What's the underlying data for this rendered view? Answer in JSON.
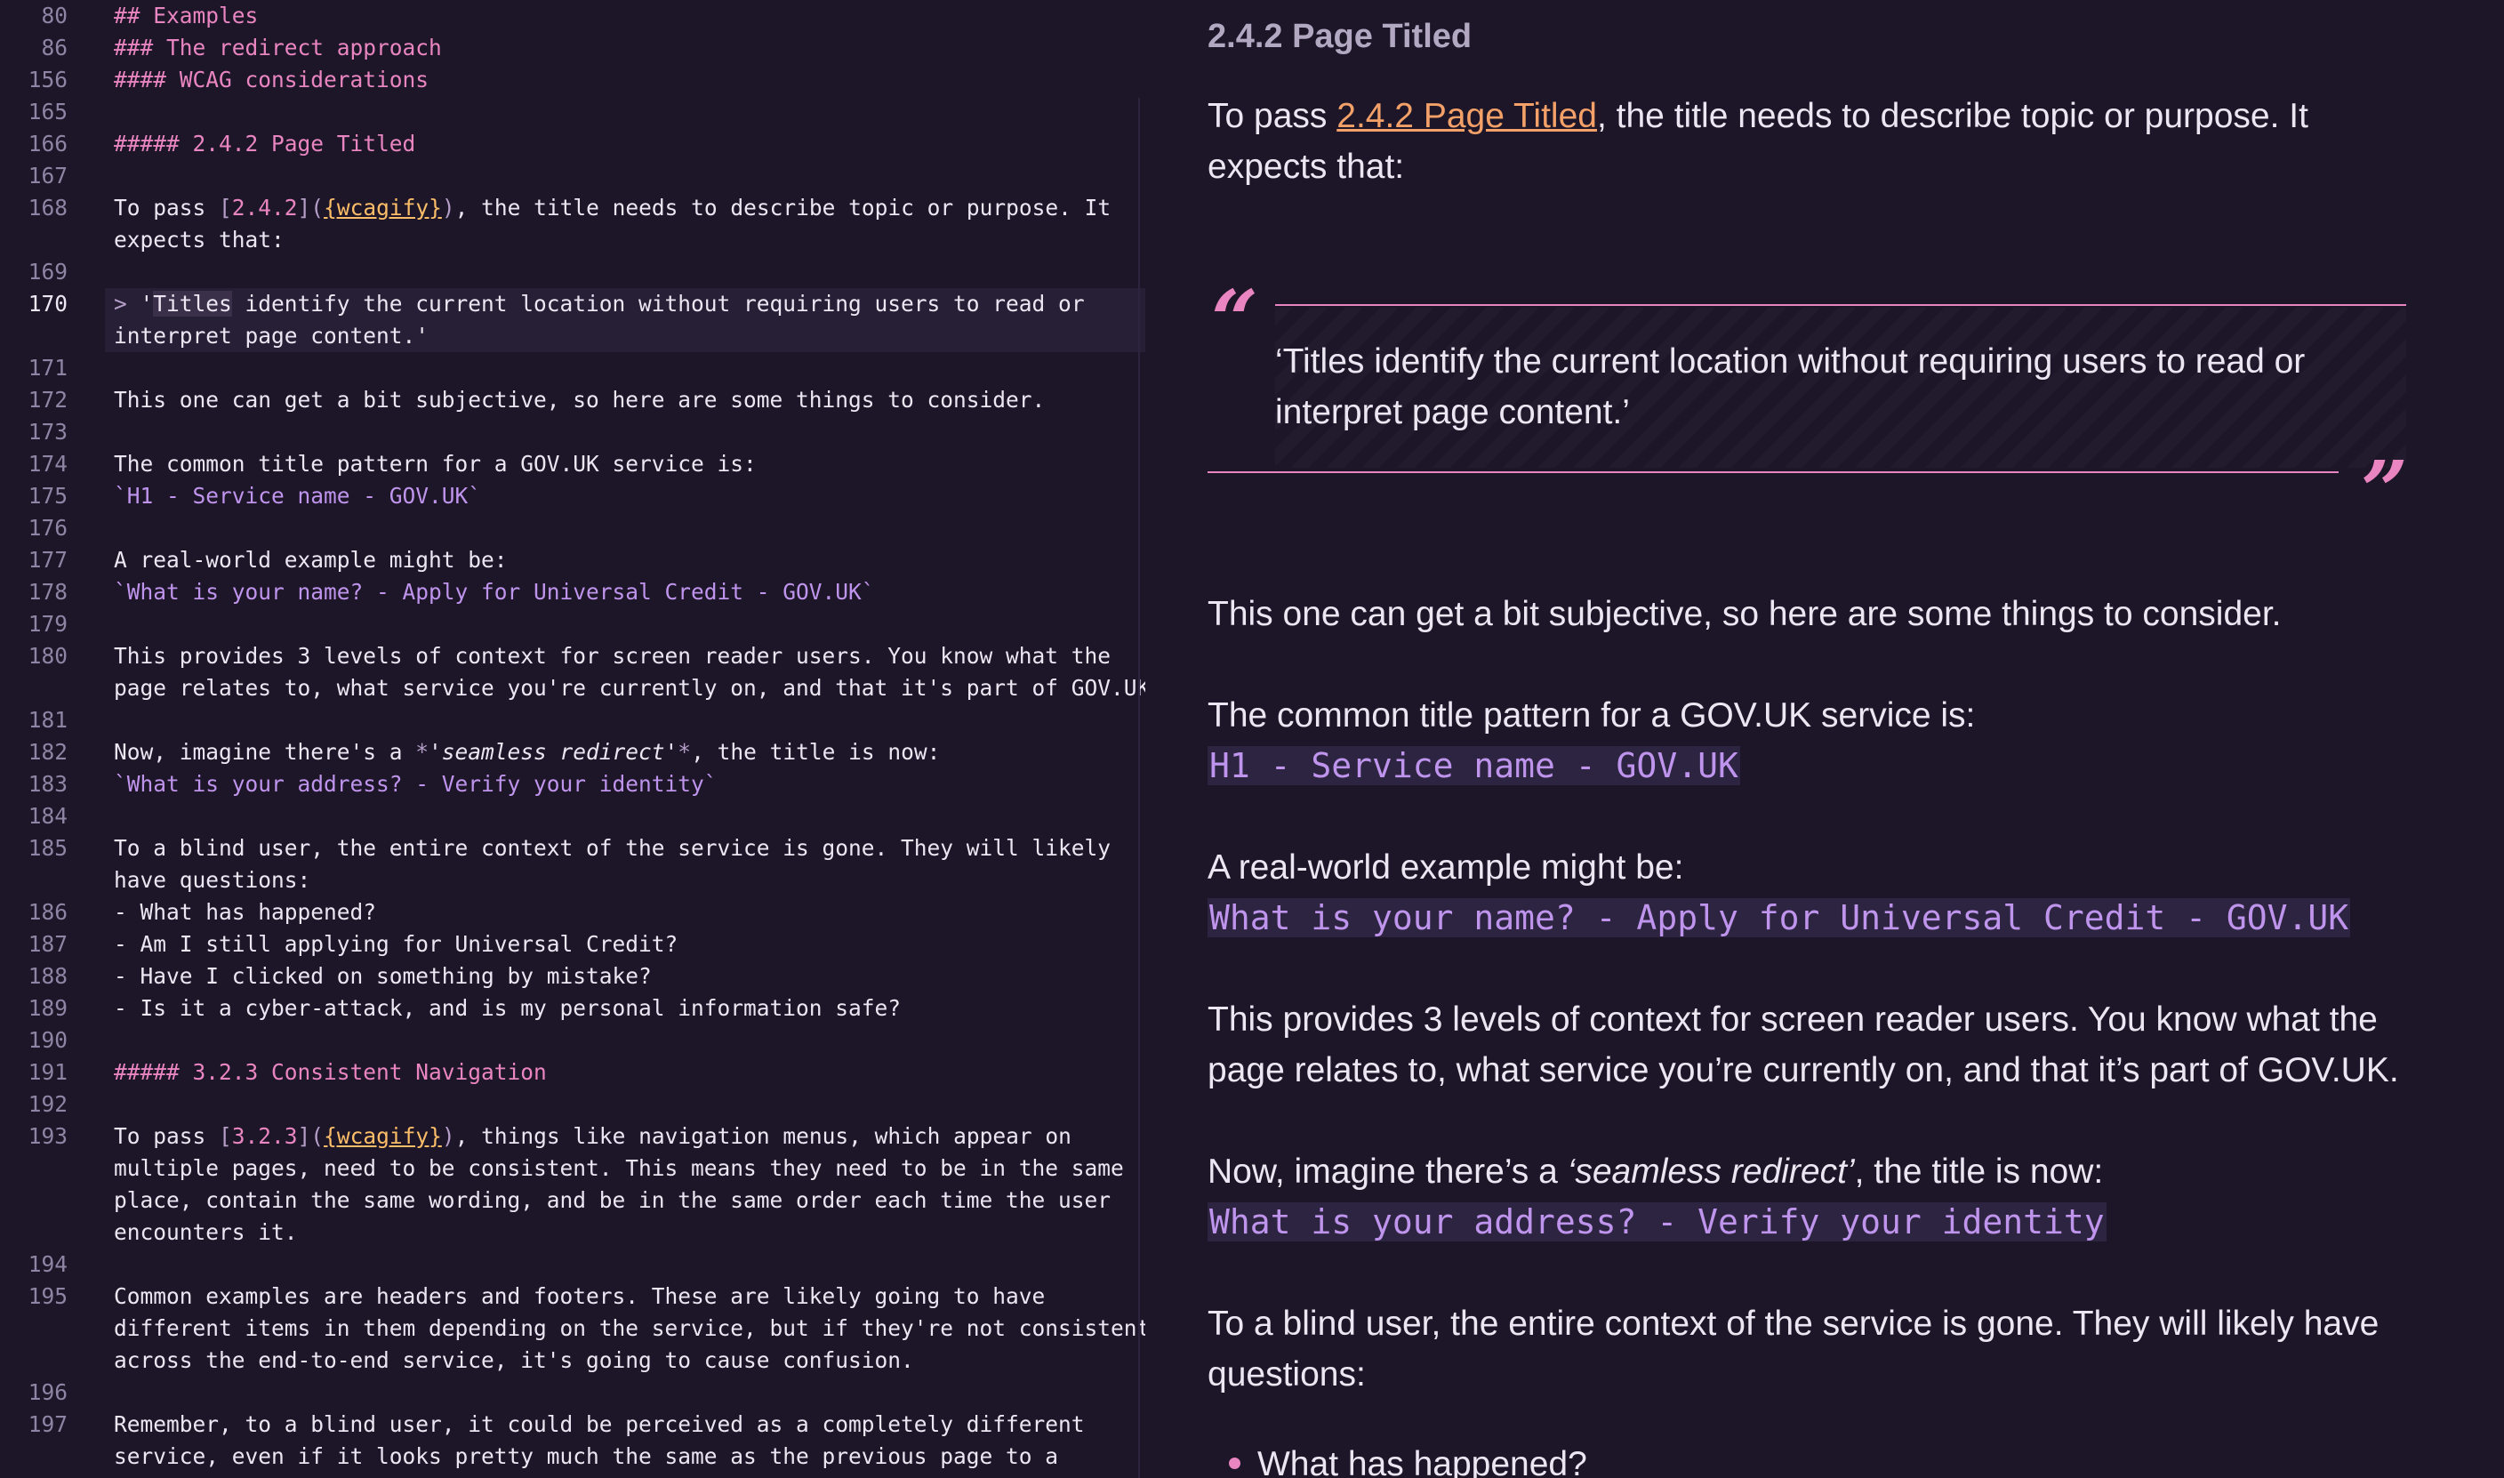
{
  "editor": {
    "sticky": [
      {
        "ln": "80",
        "md": "## ",
        "text": "Examples"
      },
      {
        "ln": "86",
        "md": "### ",
        "text": "The redirect approach"
      },
      {
        "ln": "156",
        "md": "#### ",
        "text": "WCAG considerations"
      }
    ],
    "lines": [
      {
        "ln": "165"
      },
      {
        "ln": "166",
        "md": "##### ",
        "text": "2.4.2 Page Titled"
      },
      {
        "ln": "167"
      },
      {
        "ln": "168",
        "pre": "To pass ",
        "lb": "[",
        "label": "2.4.2",
        "mid": "](",
        "url": "{wcagify}",
        "rp": ")",
        "post": ", the title needs to describe topic or purpose. It",
        "cont": "expects that:"
      },
      {
        "ln": "169"
      },
      {
        "ln": "170",
        "gt": "> ",
        "q1": "'",
        "sel": "Titles",
        "post": " identify the current location without requiring users to read or",
        "cont": "interpret page content.'"
      },
      {
        "ln": "171"
      },
      {
        "ln": "172",
        "text": "This one can get a bit subjective, so here are some things to consider."
      },
      {
        "ln": "173"
      },
      {
        "ln": "174",
        "text": "The common title pattern for a GOV.UK service is:"
      },
      {
        "ln": "175",
        "code": "`H1 - Service name - GOV.UK`"
      },
      {
        "ln": "176"
      },
      {
        "ln": "177",
        "text": "A real-world example might be:"
      },
      {
        "ln": "178",
        "code": "`What is your name? - Apply for Universal Credit - GOV.UK`"
      },
      {
        "ln": "179"
      },
      {
        "ln": "180",
        "text": "This provides 3 levels of context for screen reader users. You know what the",
        "cont": "page relates to, what service you're currently on, and that it's part of GOV.UK."
      },
      {
        "ln": "181"
      },
      {
        "ln": "182",
        "pre": "Now, imagine there's a ",
        "em_o": "*",
        "em": "'seamless redirect'",
        "em_c": "*",
        "post": ", the title is now:"
      },
      {
        "ln": "183",
        "code": "`What is your address? - Verify your identity`"
      },
      {
        "ln": "184"
      },
      {
        "ln": "185",
        "text": "To a blind user, the entire context of the service is gone. They will likely",
        "cont": "have questions:"
      },
      {
        "ln": "186",
        "text": "- What has happened?"
      },
      {
        "ln": "187",
        "text": "- Am I still applying for Universal Credit?"
      },
      {
        "ln": "188",
        "text": "- Have I clicked on something by mistake?"
      },
      {
        "ln": "189",
        "text": "- Is it a cyber-attack, and is my personal information safe?"
      },
      {
        "ln": "190"
      },
      {
        "ln": "191",
        "md": "##### ",
        "text": "3.2.3 Consistent Navigation"
      },
      {
        "ln": "192"
      },
      {
        "ln": "193",
        "pre": "To pass ",
        "lb": "[",
        "label": "3.2.3",
        "mid": "](",
        "url": "{wcagify}",
        "rp": ")",
        "post": ", things like navigation menus, which appear on",
        "cont": "multiple pages, need to be consistent. This means they need to be in the same",
        "cont2": "place, contain the same wording, and be in the same order each time the user",
        "cont3": "encounters it."
      },
      {
        "ln": "194"
      },
      {
        "ln": "195",
        "text": "Common examples are headers and footers. These are likely going to have",
        "cont": "different items in them depending on the service, but if they're not consistent",
        "cont2": "across the end-to-end service, it's going to cause confusion."
      },
      {
        "ln": "196"
      },
      {
        "ln": "197",
        "text": "Remember, to a blind user, it could be perceived as a completely different",
        "cont": "service, even if it looks pretty much the same as the previous page to a"
      }
    ]
  },
  "preview": {
    "heading": "2.4.2 Page Titled",
    "p1_pre": "To pass ",
    "p1_link": "2.4.2 Page Titled",
    "p1_post": ", the title needs to describe topic or purpose. It",
    "p1_cont": "expects that:",
    "quote_open": "“",
    "quote_close": "”",
    "quote_l1": "‘Titles identify the current location without requiring users to read or",
    "quote_l2": "interpret page content.’",
    "p2": "This one can get a bit subjective, so here are some things to consider.",
    "p3": "The common title pattern for a GOV.UK service is:",
    "p3_code": "H1 - Service name - GOV.UK",
    "p4": "A real-world example might be:",
    "p4_code": "What is your name? - Apply for Universal Credit - GOV.UK",
    "p5_l1": "This provides 3 levels of context for screen reader users. You know what the",
    "p5_l2": "page relates to, what service you’re currently on, and that it’s part of GOV.UK.",
    "p6_pre": "Now, imagine there’s a ",
    "p6_em": "‘seamless redirect’",
    "p6_post": ", the title is now:",
    "p6_code": "What is your address? - Verify your identity",
    "p7_l1": "To a blind user, the entire context of the service is gone. They will likely have",
    "p7_l2": "questions:",
    "bullet1": "What has happened?"
  },
  "colors": {
    "background": "#1d1628",
    "heading_md": "#e985c0",
    "link_url": "#fbbd68",
    "inline_code": "#bf94ec",
    "preview_link": "#f3a168",
    "quote_accent": "#e985c0"
  }
}
